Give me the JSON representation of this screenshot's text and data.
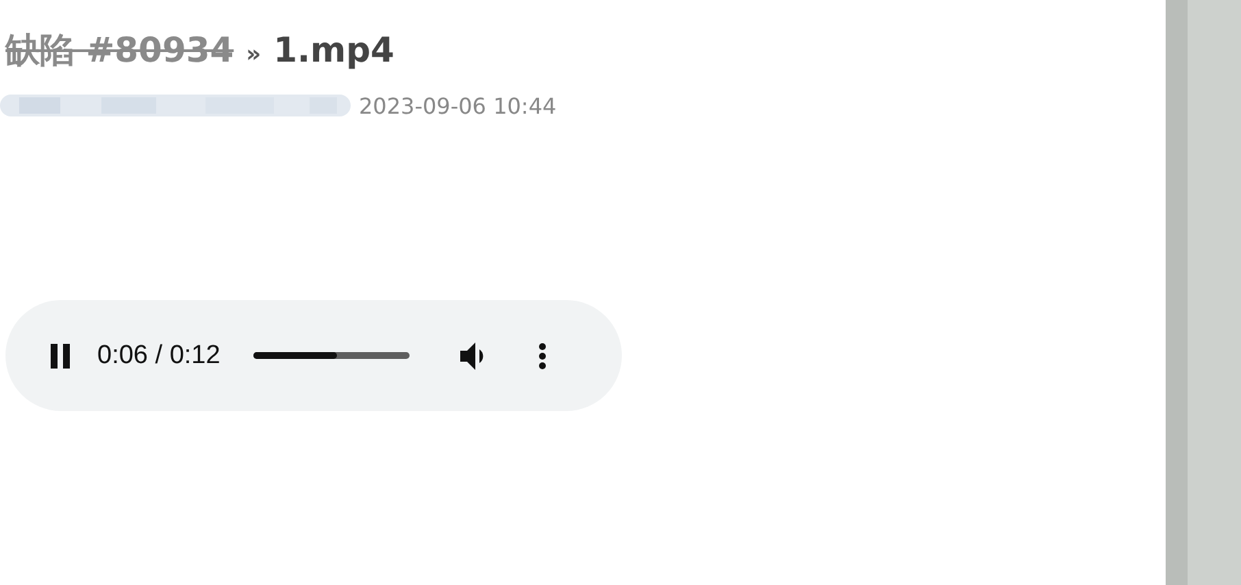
{
  "title": {
    "parent": "缺陷 #80934",
    "parent_closed": true,
    "separator": "»",
    "name": "1.mp4"
  },
  "meta": {
    "author_redacted": true,
    "date": "2023-09-06 10:44"
  },
  "player": {
    "playing": true,
    "time": "0:06 / 0:12",
    "level": 0.54
  }
}
